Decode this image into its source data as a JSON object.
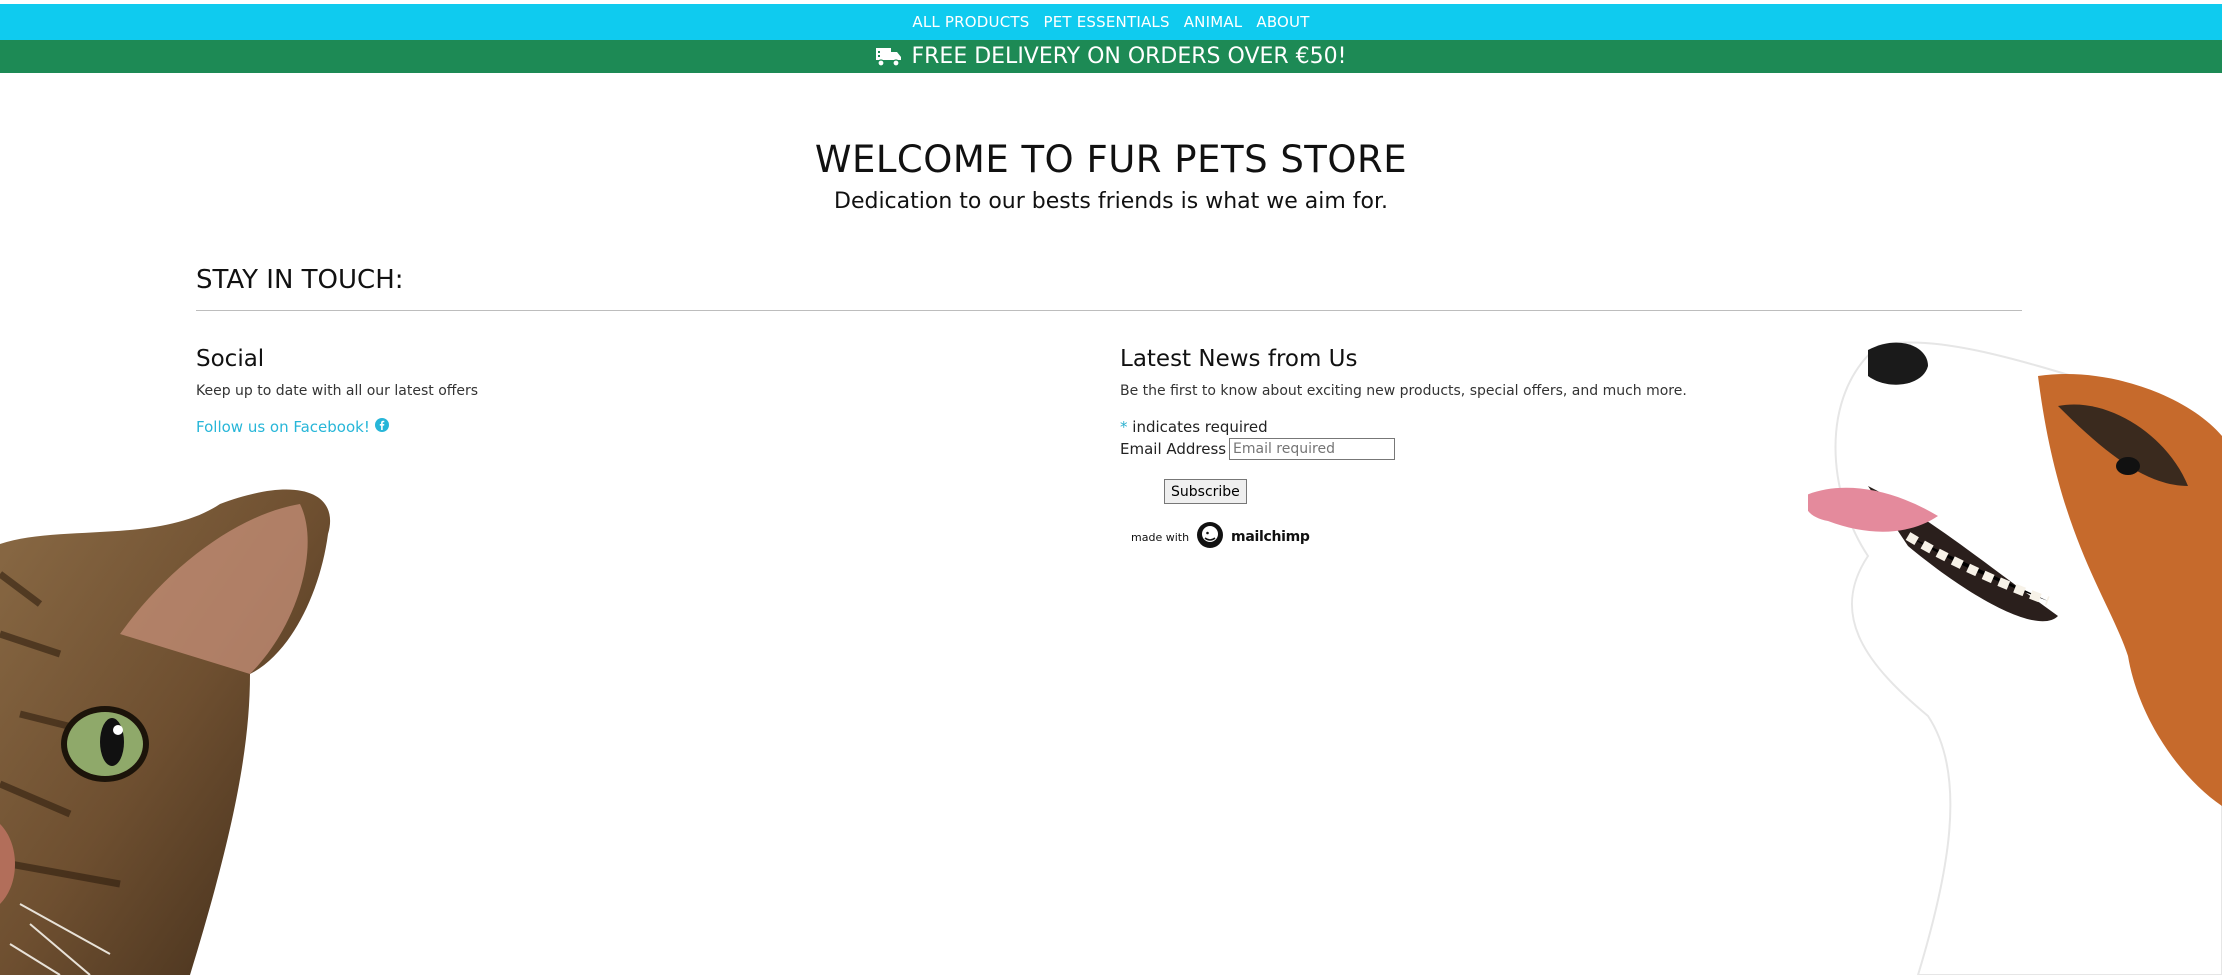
{
  "nav": {
    "items": [
      {
        "label": "ALL PRODUCTS"
      },
      {
        "label": "PET ESSENTIALS"
      },
      {
        "label": "ANIMAL"
      },
      {
        "label": "ABOUT"
      }
    ]
  },
  "promo": {
    "icon": "truck-icon",
    "text": "FREE DELIVERY ON ORDERS OVER €50!"
  },
  "hero": {
    "title": "WELCOME TO FUR PETS STORE",
    "subtitle": "Dedication to our bests friends is what we aim for."
  },
  "stay_in_touch": {
    "heading": "STAY IN TOUCH:"
  },
  "social": {
    "title": "Social",
    "text": "Keep up to date with all our latest offers",
    "link_label": "Follow us on Facebook!",
    "link_icon": "facebook-icon"
  },
  "newsletter": {
    "title": "Latest News from Us",
    "text": "Be the first to know about exciting new products, special offers, and much more.",
    "required_marker": "*",
    "required_note": "indicates required",
    "email_label": "Email Address",
    "email_placeholder": "Email required",
    "subscribe_label": "Subscribe",
    "made_with": "made with",
    "brand": "mailchimp"
  },
  "colors": {
    "nav_bg": "#0fcbef",
    "promo_bg": "#1d8a55",
    "link": "#27b6d8"
  }
}
